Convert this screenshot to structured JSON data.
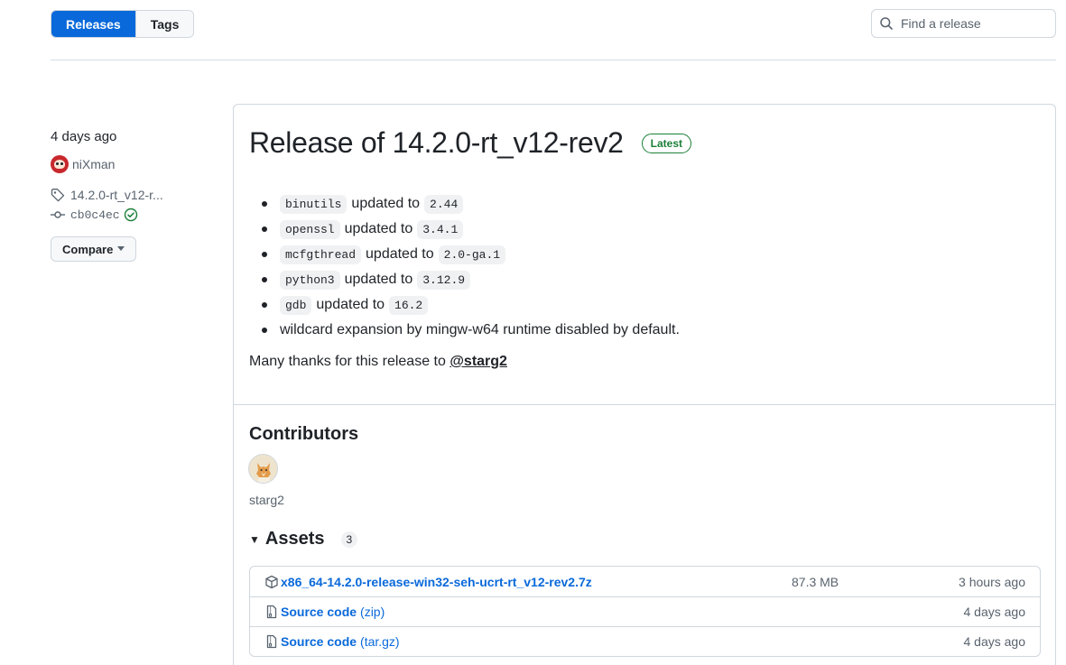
{
  "nav": {
    "releases_label": "Releases",
    "tags_label": "Tags",
    "search_placeholder": "Find a release"
  },
  "sidebar": {
    "date": "4 days ago",
    "author": "niXman",
    "tag": "14.2.0-rt_v12-r...",
    "commit": "cb0c4ec",
    "compare_label": "Compare"
  },
  "release": {
    "title": "Release of 14.2.0-rt_v12-rev2",
    "badge": "Latest",
    "notes": [
      {
        "pkg": "binutils",
        "text": "updated to",
        "ver": "2.44"
      },
      {
        "pkg": "openssl",
        "text": "updated to",
        "ver": "3.4.1"
      },
      {
        "pkg": "mcfgthread",
        "text": "updated to",
        "ver": "2.0-ga.1"
      },
      {
        "pkg": "python3",
        "text": "updated to",
        "ver": "3.12.9"
      },
      {
        "pkg": "gdb",
        "text": "updated to",
        "ver": "16.2"
      }
    ],
    "note_plain": "wildcard expansion by mingw-w64 runtime disabled by default.",
    "thanks_prefix": "Many thanks for this release to ",
    "thanks_user": "@starg2"
  },
  "contributors": {
    "heading": "Contributors",
    "names": [
      "starg2"
    ]
  },
  "assets": {
    "heading": "Assets",
    "count": "3",
    "items": [
      {
        "name": "x86_64-14.2.0-release-win32-seh-ucrt-rt_v12-rev2.7z",
        "ext": "",
        "size": "87.3 MB",
        "date": "3 hours ago"
      },
      {
        "name": "Source code",
        "ext": "(zip)",
        "size": "",
        "date": "4 days ago"
      },
      {
        "name": "Source code",
        "ext": "(tar.gz)",
        "size": "",
        "date": "4 days ago"
      }
    ]
  },
  "colors": {
    "accent": "#0969da",
    "success": "#1a7f37"
  }
}
